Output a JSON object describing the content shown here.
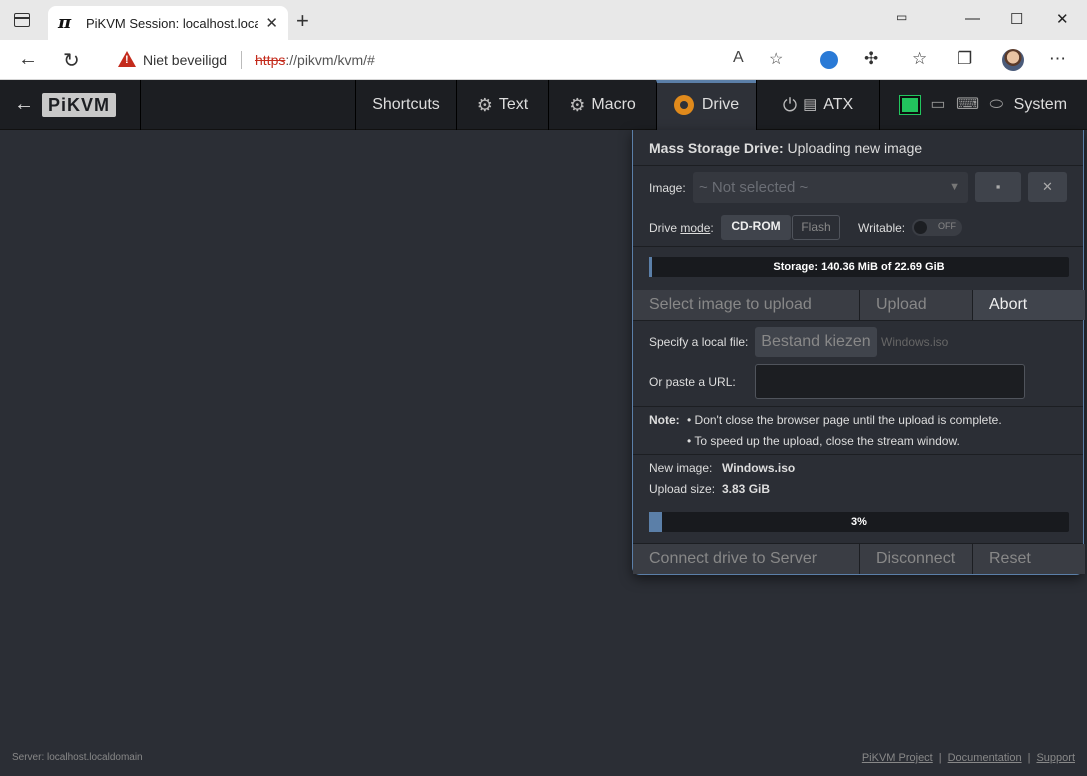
{
  "browser": {
    "tab_title": "PiKVM Session: localhost.localdomain",
    "tab_favicon": "π",
    "not_secure": "Niet beveiligd",
    "url_proto": "https",
    "url_rest": "://pikvm/kvm/#"
  },
  "kvm_nav": {
    "logo": "PiKVM",
    "items": [
      {
        "label": "Shortcuts",
        "icon": ""
      },
      {
        "label": "Text",
        "icon": "gear-icon"
      },
      {
        "label": "Macro",
        "icon": "gear-icon"
      },
      {
        "label": "Drive",
        "icon": "drive-icon"
      },
      {
        "label": "ATX",
        "icon": "power-icon"
      },
      {
        "label": "System",
        "icon": "mouse-icon"
      }
    ]
  },
  "drive_panel": {
    "title_bold": "Mass Storage Drive:",
    "title_rest": "Uploading new image",
    "image_label": "Image:",
    "image_placeholder": "~ Not selected ~",
    "drive_mode_label_a": "Drive ",
    "drive_mode_label_b": "mode",
    "drive_mode_label_c": ":",
    "mode_cdrom": "CD-ROM",
    "mode_flash": "Flash",
    "writable_label": "Writable:",
    "writable_state": "OFF",
    "storage_text": "Storage: 140.36 MiB of 22.69 GiB",
    "storage_fraction": 0.006,
    "tab_select": "Select image to upload",
    "tab_upload": "Upload",
    "tab_abort": "Abort",
    "local_file_label": "Specify a local file:",
    "file_button": "Bestand kiezen",
    "file_name": "Windows.iso",
    "url_label": "Or paste a URL:",
    "note_label": "Note:",
    "note_1": "• Don't close the browser page until the upload is complete.",
    "note_2": "• To speed up the upload, close the stream window.",
    "new_image_label": "New image:",
    "new_image_value": "Windows.iso",
    "upload_size_label": "Upload size:",
    "upload_size_value": "3.83 GiB",
    "upload_progress_text": "3%",
    "upload_progress": 0.03,
    "btn_connect": "Connect drive to Server",
    "btn_disconnect": "Disconnect",
    "btn_reset": "Reset"
  },
  "footer": {
    "server": "Server: localhost.localdomain",
    "link_project": "PiKVM Project",
    "link_docs": "Documentation",
    "link_support": "Support",
    "separator": "|"
  },
  "colors": {
    "accent": "#5b7fa8",
    "drive_icon": "#e08a1c",
    "net_ok": "#22c55e",
    "warning": "#c42b1c"
  }
}
